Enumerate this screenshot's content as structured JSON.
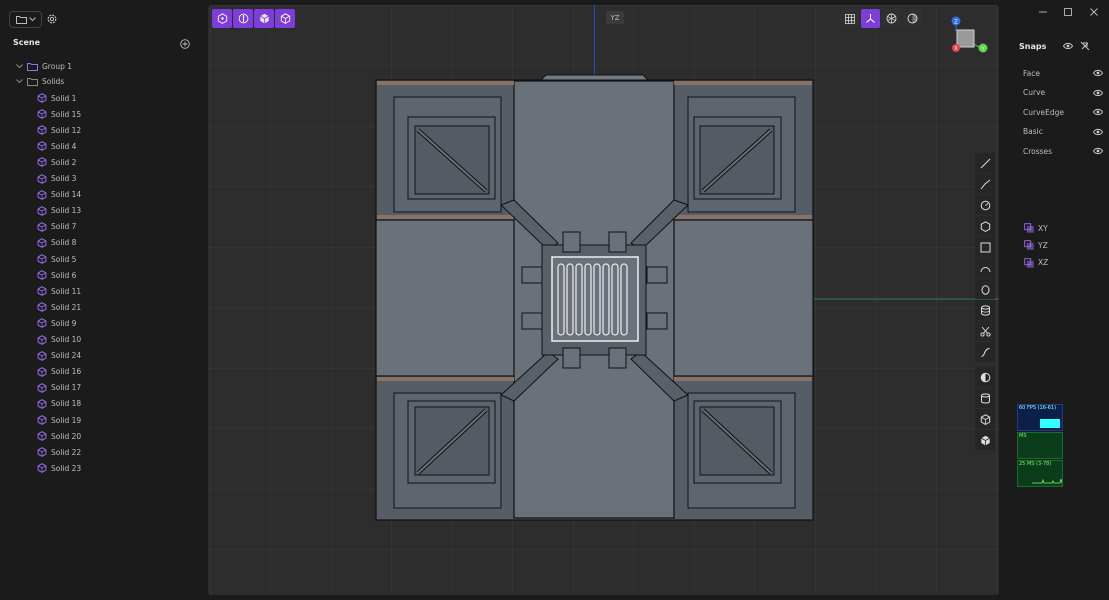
{
  "scene": {
    "title": "Scene",
    "group_label": "Group 1",
    "solids_label": "Solids",
    "items": [
      "Solid 1",
      "Solid 15",
      "Solid 12",
      "Solid 4",
      "Solid 2",
      "Solid 3",
      "Solid 14",
      "Solid 13",
      "Solid 7",
      "Solid 8",
      "Solid 5",
      "Solid 6",
      "Solid 11",
      "Solid 21",
      "Solid 9",
      "Solid 10",
      "Solid 24",
      "Solid 16",
      "Solid 17",
      "Solid 18",
      "Solid 19",
      "Solid 20",
      "Solid 22",
      "Solid 23"
    ]
  },
  "viewport": {
    "view_label": "YZ"
  },
  "gizmo": {
    "z_label": "Z",
    "x_label": "X",
    "y_label": "Y"
  },
  "snaps": {
    "title": "Snaps",
    "items": [
      "Face",
      "Curve",
      "CurveEdge",
      "Basic",
      "Crosses"
    ]
  },
  "planes": [
    "XY",
    "YZ",
    "XZ"
  ],
  "stats": {
    "fps": "60 FPS (16-61)",
    "ms": "MS",
    "mem": "25 MS (3-78)"
  },
  "colors": {
    "accent": "#7d3ddb",
    "icon": "#9b6cf0",
    "grid": "#3a3a3a",
    "body": "#6a717a"
  }
}
